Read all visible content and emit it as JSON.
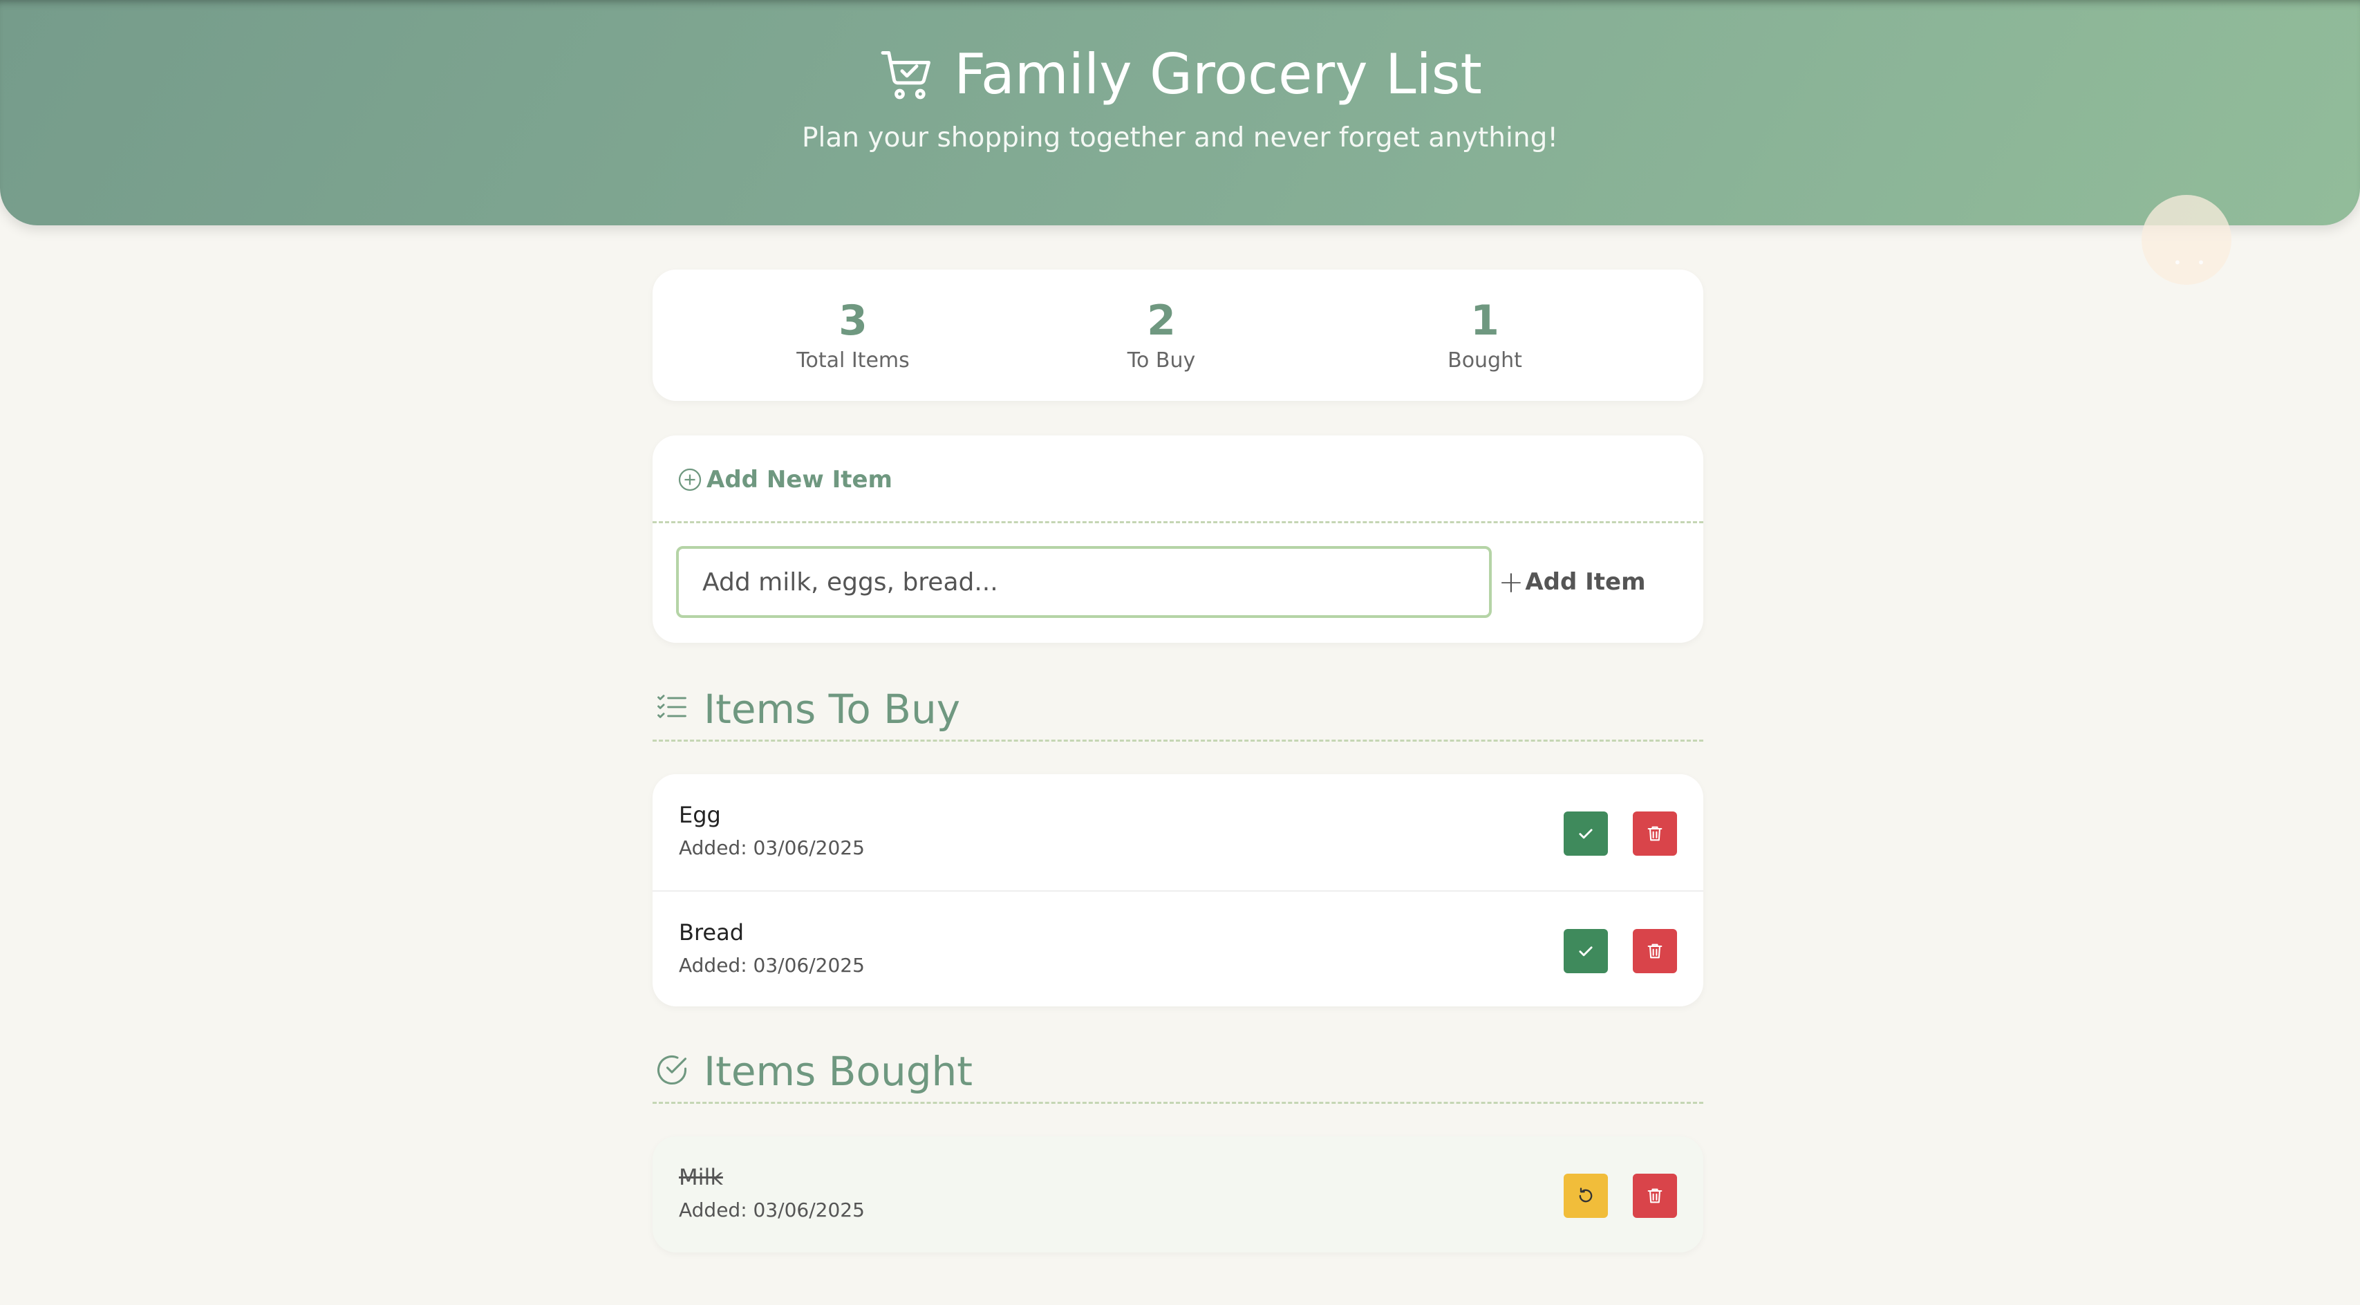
{
  "header": {
    "title": "Family Grocery List",
    "subtitle": "Plan your shopping together and never forget anything!",
    "icon": "cart-check-icon"
  },
  "stats": [
    {
      "value": "3",
      "label": "Total Items"
    },
    {
      "value": "2",
      "label": "To Buy"
    },
    {
      "value": "1",
      "label": "Bought"
    }
  ],
  "add_form": {
    "title": "Add New Item",
    "input_value": "",
    "placeholder": "Add milk, eggs, bread...",
    "button_label": "Add Item"
  },
  "sections": {
    "to_buy_title": "Items To Buy",
    "bought_title": "Items Bought"
  },
  "to_buy": [
    {
      "name": "Egg",
      "added": "Added: 03/06/2025"
    },
    {
      "name": "Bread",
      "added": "Added: 03/06/2025"
    }
  ],
  "bought": [
    {
      "name": "Milk",
      "added": "Added: 03/06/2025"
    }
  ],
  "colors": {
    "accent": "#6f9880",
    "check": "#3f8a5c",
    "delete": "#d9444a",
    "restore": "#f1bd3a"
  }
}
